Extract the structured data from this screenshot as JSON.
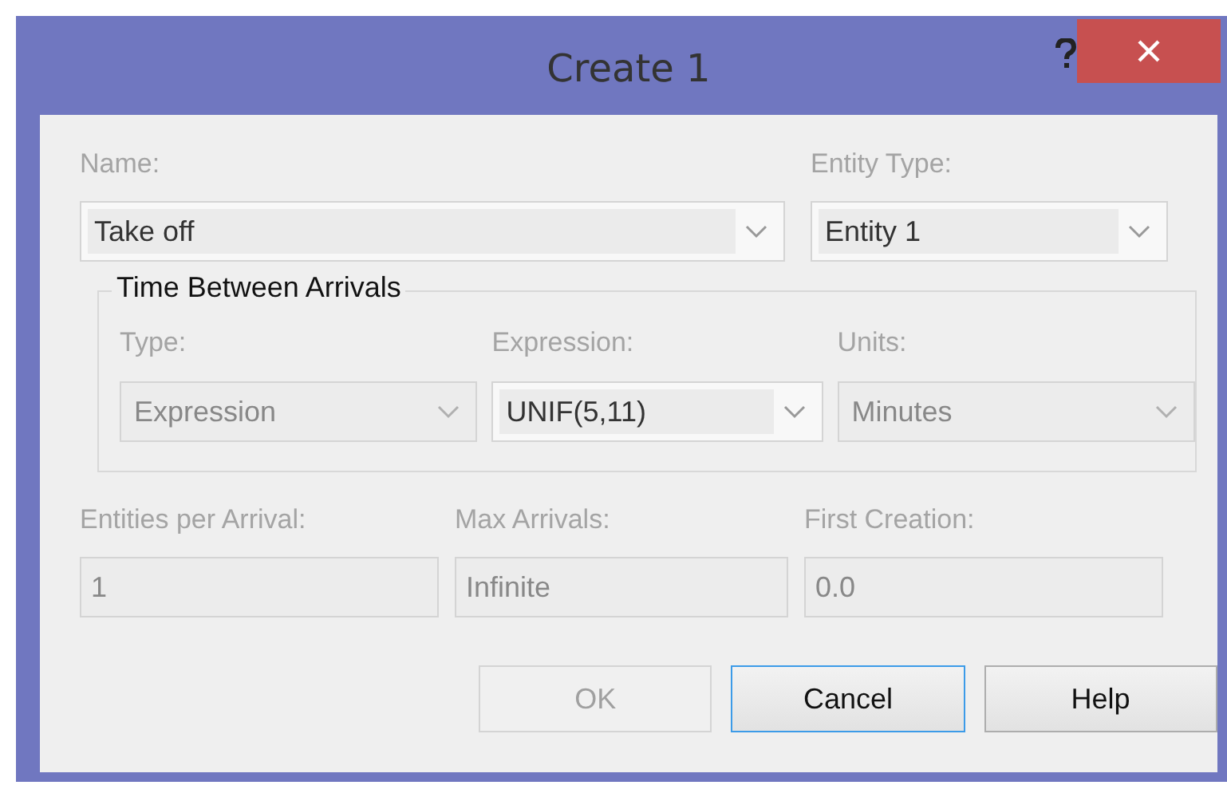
{
  "window": {
    "title": "Create 1"
  },
  "top_fields": [
    {
      "label": "Name:",
      "value": "Take off",
      "kind": "combo",
      "disabled": false
    },
    {
      "label": "Entity Type:",
      "value": "Entity 1",
      "kind": "combo",
      "disabled": false
    }
  ],
  "group": {
    "title": "Time Between Arrivals",
    "fields": [
      {
        "label": "Type:",
        "value": "Expression",
        "kind": "combo",
        "disabled": true
      },
      {
        "label": "Expression:",
        "value": "UNIF(5,11)",
        "kind": "combo",
        "disabled": false
      },
      {
        "label": "Units:",
        "value": "Minutes",
        "kind": "combo",
        "disabled": true
      }
    ]
  },
  "bottom_fields": [
    {
      "label": "Entities per Arrival:",
      "value": "1",
      "kind": "text",
      "disabled": true
    },
    {
      "label": "Max Arrivals:",
      "value": "Infinite",
      "kind": "text",
      "disabled": true
    },
    {
      "label": "First Creation:",
      "value": "0.0",
      "kind": "text",
      "disabled": true
    }
  ],
  "buttons": [
    {
      "label": "OK",
      "disabled": true,
      "focused": false
    },
    {
      "label": "Cancel",
      "disabled": false,
      "focused": true
    },
    {
      "label": "Help",
      "disabled": false,
      "focused": false
    }
  ]
}
